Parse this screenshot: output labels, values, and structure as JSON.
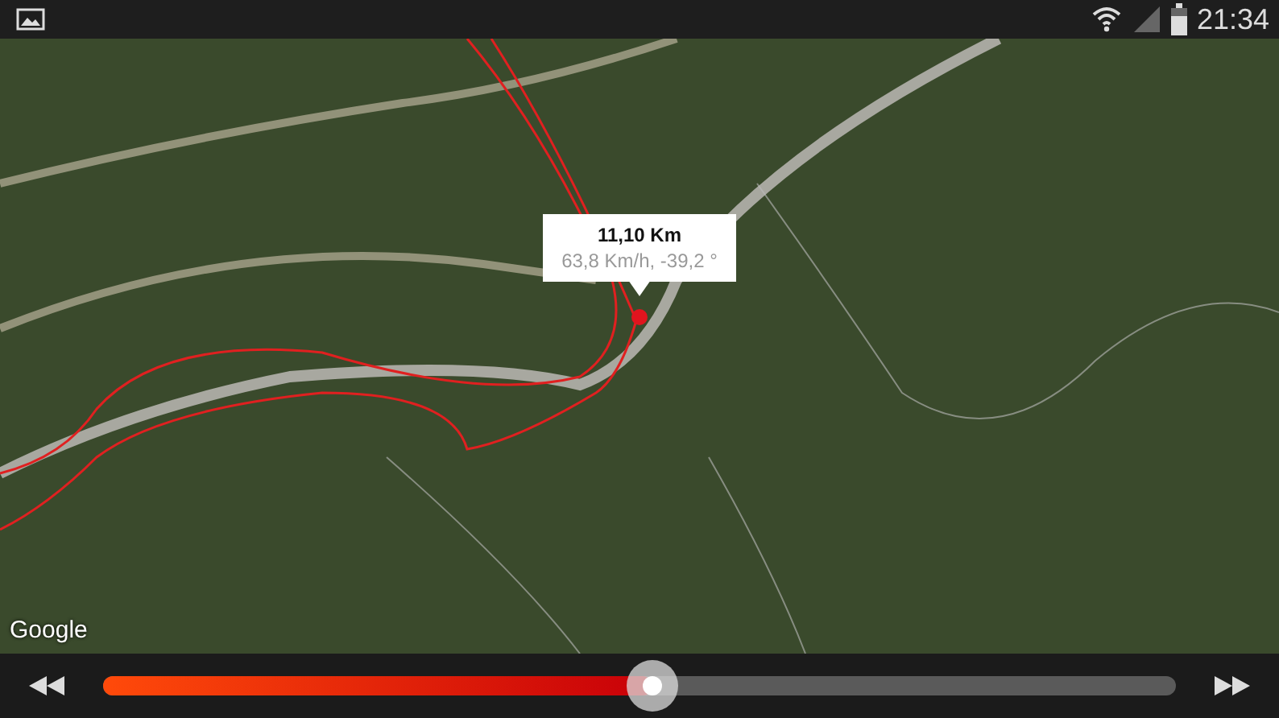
{
  "status_bar": {
    "time": "21:34"
  },
  "map": {
    "attribution": "Google",
    "popup": {
      "distance": "11,10 Km",
      "details": "63,8 Km/h, -39,2 °"
    }
  },
  "playback": {
    "level": 0.512
  }
}
